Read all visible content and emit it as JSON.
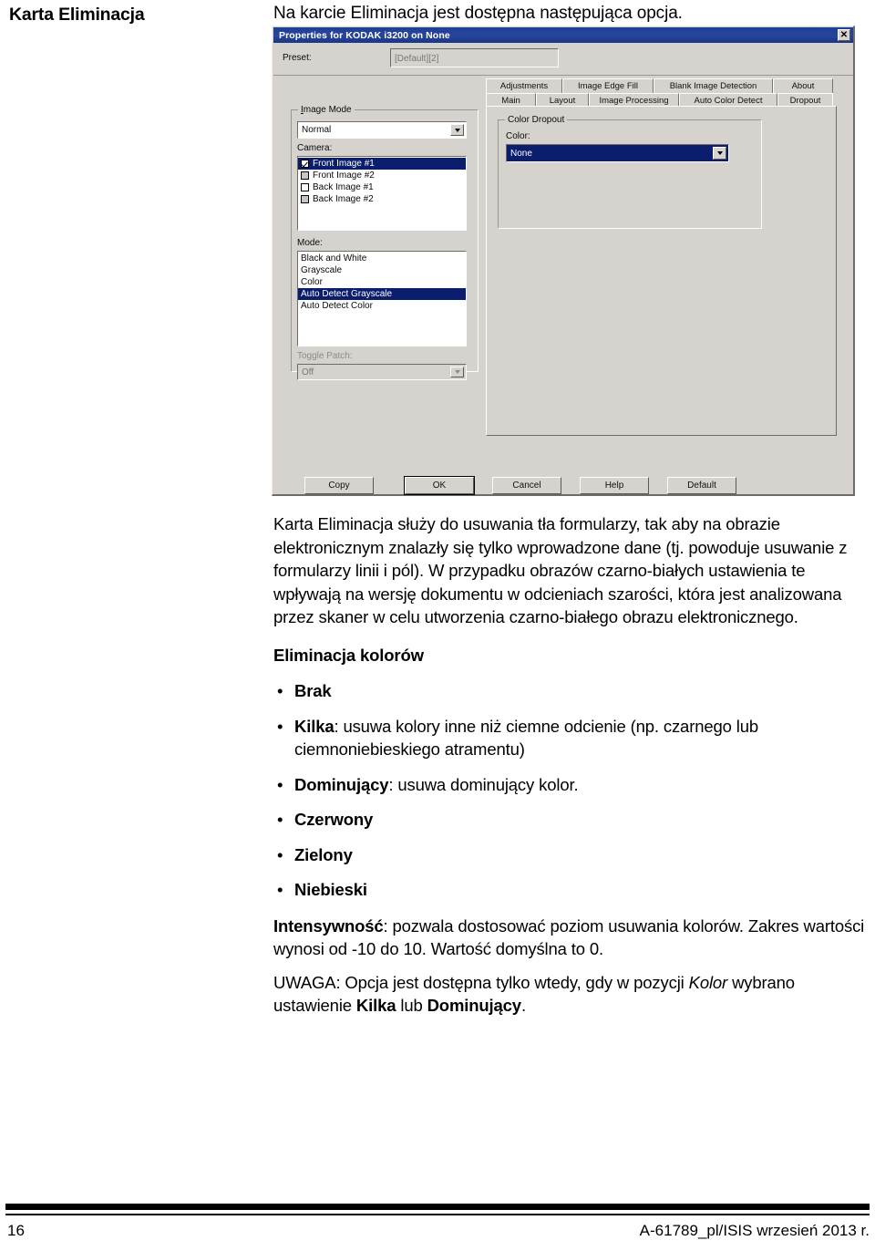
{
  "page": {
    "margin_heading": "Karta Eliminacja",
    "intro": "Na karcie Eliminacja jest dostępna następująca opcja."
  },
  "dialog": {
    "title": "Properties for KODAK i3200 on None",
    "close_label": "✕",
    "preset": {
      "label": "Preset:",
      "value": "[Default][2]"
    },
    "image_mode": {
      "group_title": "Image Mode",
      "mode_combo_value": "Normal",
      "camera_label": "Camera:",
      "camera_items": [
        {
          "label": "Front Image #1",
          "checked": true,
          "gray": false,
          "selected": true
        },
        {
          "label": "Front Image #2",
          "checked": false,
          "gray": true,
          "selected": false
        },
        {
          "label": "Back Image #1",
          "checked": false,
          "gray": false,
          "selected": false
        },
        {
          "label": "Back Image #2",
          "checked": false,
          "gray": true,
          "selected": false
        }
      ],
      "mode_label": "Mode:",
      "mode_items": [
        {
          "label": "Black and White",
          "selected": false
        },
        {
          "label": "Grayscale",
          "selected": false
        },
        {
          "label": "Color",
          "selected": false
        },
        {
          "label": "Auto Detect Grayscale",
          "selected": true
        },
        {
          "label": "Auto Detect Color",
          "selected": false
        }
      ],
      "toggle_patch_label": "Toggle Patch:",
      "toggle_patch_value": "Off"
    },
    "tabs_row1": [
      "Adjustments",
      "Image Edge Fill",
      "Blank Image Detection",
      "About"
    ],
    "tabs_row2": [
      "Main",
      "Layout",
      "Image Processing",
      "Auto Color Detect",
      "Dropout"
    ],
    "active_tab": "Dropout",
    "color_dropout": {
      "group_title": "Color Dropout",
      "color_label": "Color:",
      "color_value": "None"
    },
    "buttons": [
      {
        "label": "Copy",
        "default": false
      },
      {
        "label": "OK",
        "default": true
      },
      {
        "label": "Cancel",
        "default": false
      },
      {
        "label": "Help",
        "default": false
      },
      {
        "label": "Default",
        "default": false
      }
    ]
  },
  "body": {
    "paragraph1": "Karta Eliminacja służy do usuwania tła formularzy, tak aby na obrazie elektronicznym znalazły się tylko wprowadzone dane (tj. powoduje usuwanie z formularzy linii i pól). W przypadku obrazów czarno-białych ustawienia te wpływają na wersję dokumentu w odcieniach szarości, która jest analizowana przez skaner w celu utworzenia czarno-białego obrazu elektronicznego.",
    "subheading": "Eliminacja kolorów",
    "bullets": [
      {
        "bold": "Brak",
        "rest": ""
      },
      {
        "bold": "Kilka",
        "rest": ": usuwa kolory inne niż ciemne odcienie (np. czarnego lub ciemnoniebieskiego atramentu)"
      },
      {
        "bold": "Dominujący",
        "rest": ": usuwa dominujący kolor."
      },
      {
        "bold": "Czerwony",
        "rest": ""
      },
      {
        "bold": "Zielony",
        "rest": ""
      },
      {
        "bold": "Niebieski",
        "rest": ""
      }
    ],
    "bullet_marker": "•",
    "intensity_bold": "Intensywność",
    "intensity_rest": ": pozwala dostosować poziom usuwania kolorów. Zakres wartości wynosi od -10 do 10. Wartość domyślna to 0.",
    "note_prefix": "UWAGA: Opcja jest dostępna tylko wtedy, gdy w pozycji ",
    "note_italic": "Kolor",
    "note_mid": " wybrano ustawienie ",
    "note_bold1": "Kilka",
    "note_join": " lub ",
    "note_bold2": "Dominujący",
    "note_end": "."
  },
  "footer": {
    "page_number": "16",
    "document_id": "A-61789_pl/ISIS  wrzesień 2013 r."
  }
}
